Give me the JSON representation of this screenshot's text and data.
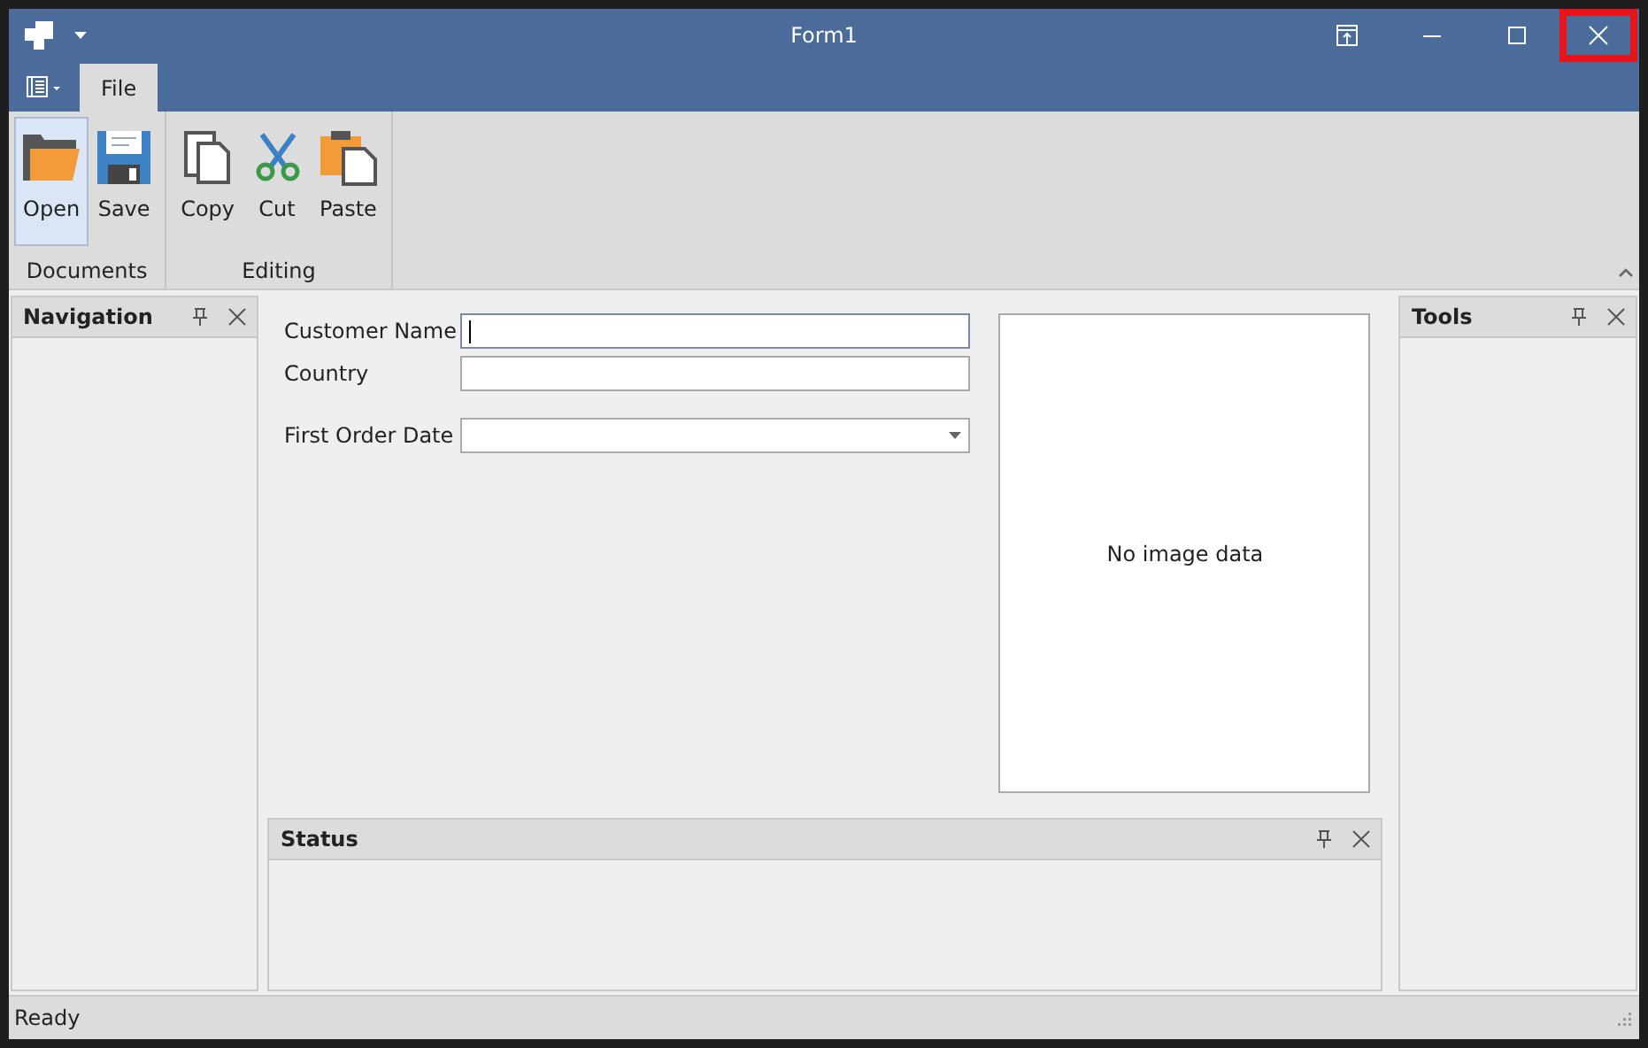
{
  "window": {
    "title": "Form1",
    "close_highlighted": true
  },
  "tabs": [
    {
      "label": "File",
      "selected": true
    }
  ],
  "ribbon": {
    "groups": [
      {
        "label": "Documents",
        "items": [
          {
            "label": "Open",
            "selected": true
          },
          {
            "label": "Save",
            "selected": false
          }
        ]
      },
      {
        "label": "Editing",
        "items": [
          {
            "label": "Copy",
            "selected": false
          },
          {
            "label": "Cut",
            "selected": false
          },
          {
            "label": "Paste",
            "selected": false
          }
        ]
      }
    ]
  },
  "navigation_panel": {
    "title": "Navigation"
  },
  "form": {
    "fields": [
      {
        "label": "Customer Name",
        "kind": "text",
        "focused": true
      },
      {
        "label": "Country",
        "kind": "text",
        "focused": false
      },
      {
        "label": "First Order Date",
        "kind": "dropdown",
        "focused": false
      }
    ]
  },
  "image_box": {
    "text": "No image data"
  },
  "tools_panel": {
    "title": "Tools"
  },
  "status_panel": {
    "title": "Status"
  },
  "status_bar": {
    "text": "Ready"
  }
}
